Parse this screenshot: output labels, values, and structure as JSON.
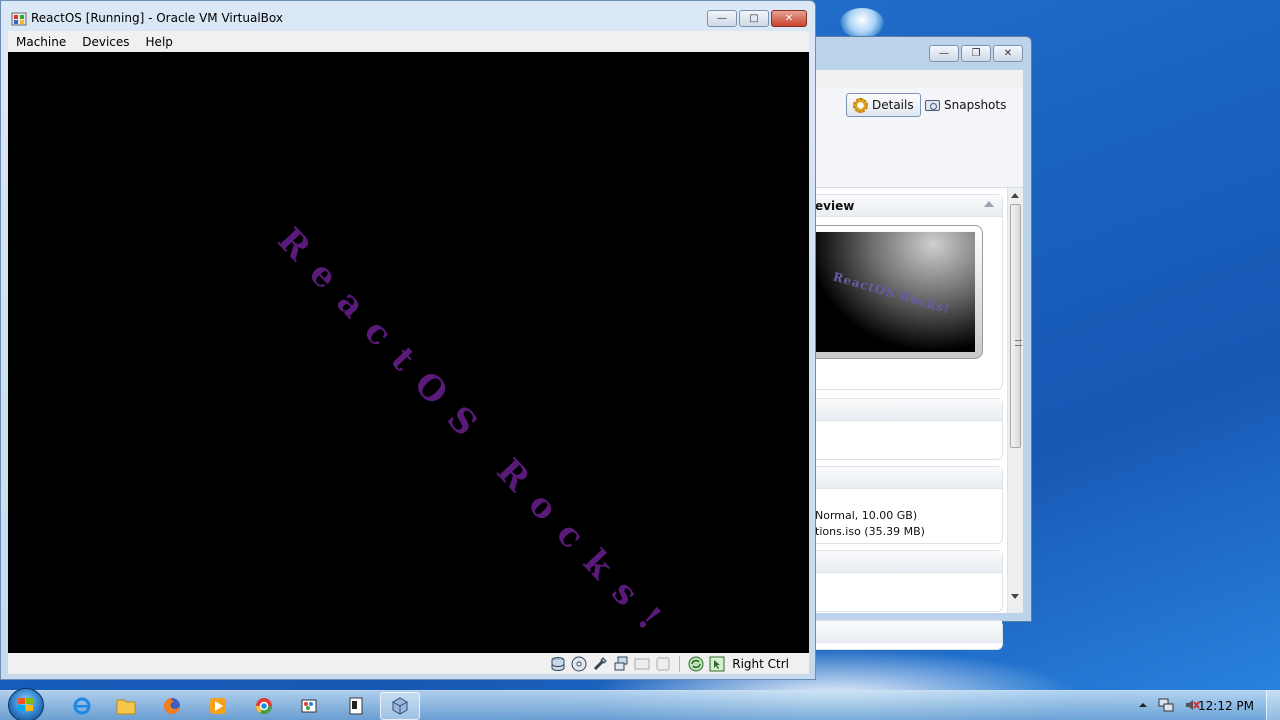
{
  "vm_window": {
    "title": "ReactOS  [Running] - Oracle VM VirtualBox",
    "menu": [
      "Machine",
      "Devices",
      "Help"
    ],
    "screen_text": "ReactOS Rocks!",
    "host_key": "Right Ctrl",
    "status_icons": [
      "hard-disk-icon",
      "optical-drive-icon",
      "usb-icon",
      "network-icon",
      "shared-folder-icon",
      "video-capture-icon",
      "virtualization-icon",
      "mouse-integration-icon"
    ]
  },
  "manager": {
    "toolbar": {
      "details_label": "Details",
      "snapshots_label": "Snapshots"
    },
    "preview_section_title": "eview",
    "preview_text": "ReactOS Rocks!",
    "storage_lines": [
      "Normal, 10.00 GB)",
      "tions.iso (35.39 MB)"
    ]
  },
  "taskbar": {
    "apps": [
      "internet-explorer-icon",
      "folder-icon",
      "firefox-icon",
      "media-player-icon",
      "chrome-icon",
      "paint-icon",
      "notepad-icon",
      "virtualbox-icon"
    ],
    "clock": "12:12 PM"
  },
  "colors": {
    "desktop": "#1b64c2",
    "screen_text": "#5a1a7a",
    "titlebar": "#dbe8f6"
  }
}
